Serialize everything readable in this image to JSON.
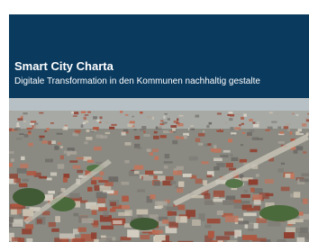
{
  "cover": {
    "title": "Smart City Charta",
    "subtitle": "Digitale Transformation in den Kommunen nachhaltig gestalte",
    "header_color": "#0a3a5e",
    "photo_subject": "aerial-city-photo"
  }
}
